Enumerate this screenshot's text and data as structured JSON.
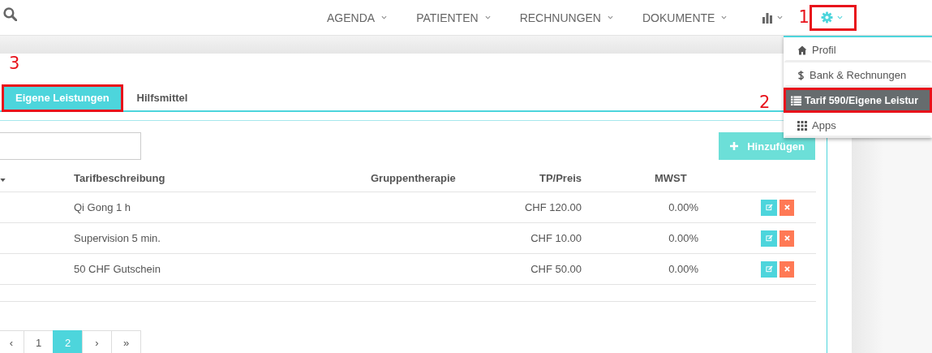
{
  "nav": {
    "items": [
      {
        "label": "AGENDA",
        "kind": "text"
      },
      {
        "label": "PATIENTEN",
        "kind": "text"
      },
      {
        "label": "RECHNUNGEN",
        "kind": "text"
      },
      {
        "label": "DOKUMENTE",
        "kind": "text"
      },
      {
        "kind": "chart"
      },
      {
        "kind": "gear",
        "highlighted": true,
        "annotation": "1"
      }
    ]
  },
  "settings_menu": {
    "items": [
      {
        "label": "Profil",
        "kind": "home",
        "selected": false,
        "highlighted": false
      },
      {
        "label": "Bank & Rechnungen",
        "kind": "dollar",
        "selected": false,
        "highlighted": false
      },
      {
        "label": "Tarif 590/Eigene Leistur",
        "kind": "list",
        "selected": true,
        "highlighted": true,
        "annotation": "2"
      },
      {
        "label": "Apps",
        "kind": "grid",
        "selected": false,
        "highlighted": false
      }
    ]
  },
  "tabs": [
    {
      "label": "Eigene Leistungen",
      "selected": true,
      "highlighted": true,
      "annotation": "3"
    },
    {
      "label": "Hilfsmittel",
      "selected": false,
      "highlighted": false
    }
  ],
  "add_button": {
    "label": "Hinzufügen"
  },
  "table": {
    "columns": [
      "Tarifbeschreibung",
      "Gruppentherapie",
      "TP/Preis",
      "MWST"
    ],
    "rows": [
      {
        "description": "Qi Gong 1 h",
        "price": "CHF 120.00",
        "vat": "0.00%"
      },
      {
        "description": "Supervision 5 min.",
        "price": "CHF 10.00",
        "vat": "0.00%"
      },
      {
        "description": "50 CHF Gutschein",
        "price": "CHF 50.00",
        "vat": "0.00%"
      }
    ]
  },
  "pagination": [
    {
      "label": "‹",
      "selected": false
    },
    {
      "label": "1",
      "selected": false
    },
    {
      "label": "2",
      "selected": true
    },
    {
      "label": "›",
      "selected": false
    },
    {
      "label": "»",
      "selected": false
    }
  ]
}
